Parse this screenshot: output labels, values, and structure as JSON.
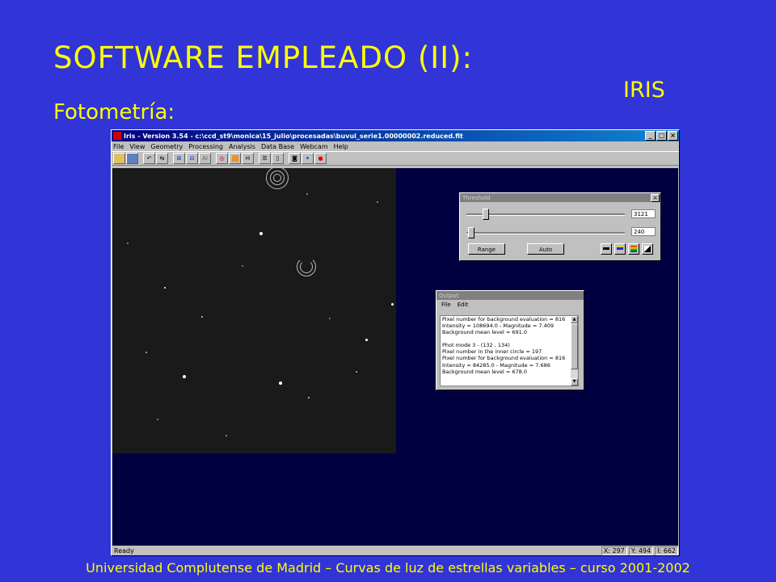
{
  "slide": {
    "title": "SOFTWARE EMPLEADO (II):",
    "subtitle": "Fotometría:",
    "software": "IRIS",
    "footer": "Universidad Complutense de Madrid – Curvas de luz de estrellas variables  – curso 2001-2002"
  },
  "window": {
    "title": "Iris - Version 3.54 - c:\\ccd_st9\\monica\\15_julio\\procesadas\\buvul_serie1.00000002.reduced.fit",
    "controls": {
      "minimize": "_",
      "maximize": "□",
      "close": "×"
    },
    "menu": [
      "File",
      "View",
      "Geometry",
      "Processing",
      "Analysis",
      "Data Base",
      "Webcam",
      "Help"
    ],
    "toolbar_icons": [
      "open-icon",
      "save-icon",
      "undo-icon",
      "redo-icon",
      "zoom-in-icon",
      "zoom-out-icon",
      "ai-icon",
      "palette-icon",
      "color-icon",
      "h-icon",
      "d-icon",
      "list-icon",
      "camera-icon",
      "target-icon",
      "record-icon"
    ]
  },
  "threshold": {
    "title": "Threshold",
    "close": "×",
    "high_value": "3121",
    "low_value": "240",
    "range_button": "Range",
    "auto_button": "Auto"
  },
  "output": {
    "title": "Output",
    "menu": [
      "File",
      "Edit"
    ],
    "lines": [
      "Pixel number for background evaluation = 816",
      "Intensity = 108694.0  -  Magnitude = 7.409",
      "Background mean level = 691.0",
      "",
      "Phot mode 3  -  (132 , 134)",
      "Pixel number in the inner circle = 197",
      "Pixel number for background evaluation = 816",
      "Intensity = 84285.0  -  Magnitude = 7.686",
      "Background mean level = 678.0"
    ]
  },
  "status": {
    "ready": "Ready",
    "x": "X: 297",
    "y": "Y: 494",
    "i": "I: 662"
  },
  "colors": {
    "slide_background": "#3134d6",
    "slide_text": "#ffff00",
    "title_bar": "#000080",
    "workspace": "#000040"
  }
}
